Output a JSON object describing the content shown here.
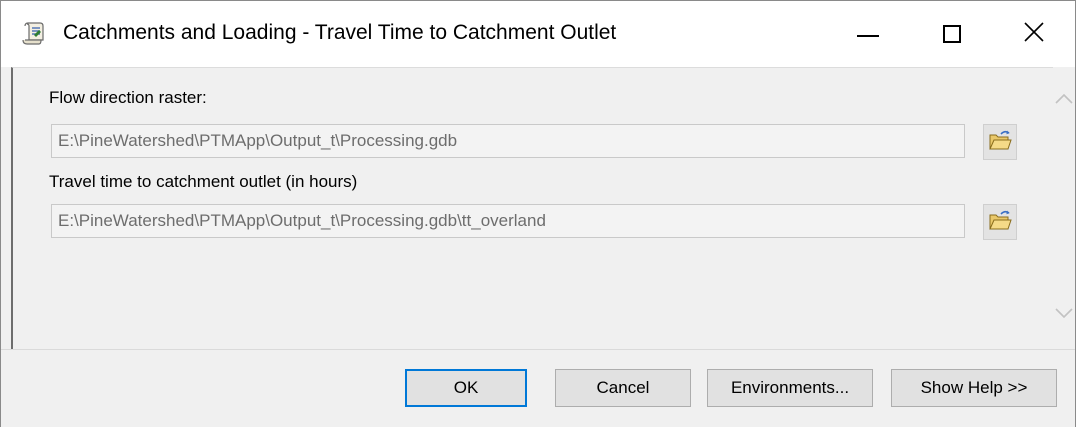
{
  "window": {
    "title": "Catchments and Loading - Travel Time to Catchment Outlet",
    "app_icon": "toolbox-script-icon",
    "controls": [
      "minimize-icon",
      "maximize-icon",
      "close-icon"
    ]
  },
  "form": {
    "flow_direction": {
      "label": "Flow direction raster:",
      "value": "E:\\PineWatershed\\PTMApp\\Output_t\\Processing.gdb"
    },
    "travel_time": {
      "label": "Travel time to catchment outlet (in hours)",
      "value": "E:\\PineWatershed\\PTMApp\\Output_t\\Processing.gdb\\tt_overland"
    },
    "browse_icon": "open-folder-icon"
  },
  "buttons": {
    "ok": "OK",
    "cancel": "Cancel",
    "environments": "Environments...",
    "show_help": "Show Help >>"
  },
  "colors": {
    "accent": "#0078d7",
    "field_text": "#6d6d6d",
    "background": "#f0f0f0"
  }
}
